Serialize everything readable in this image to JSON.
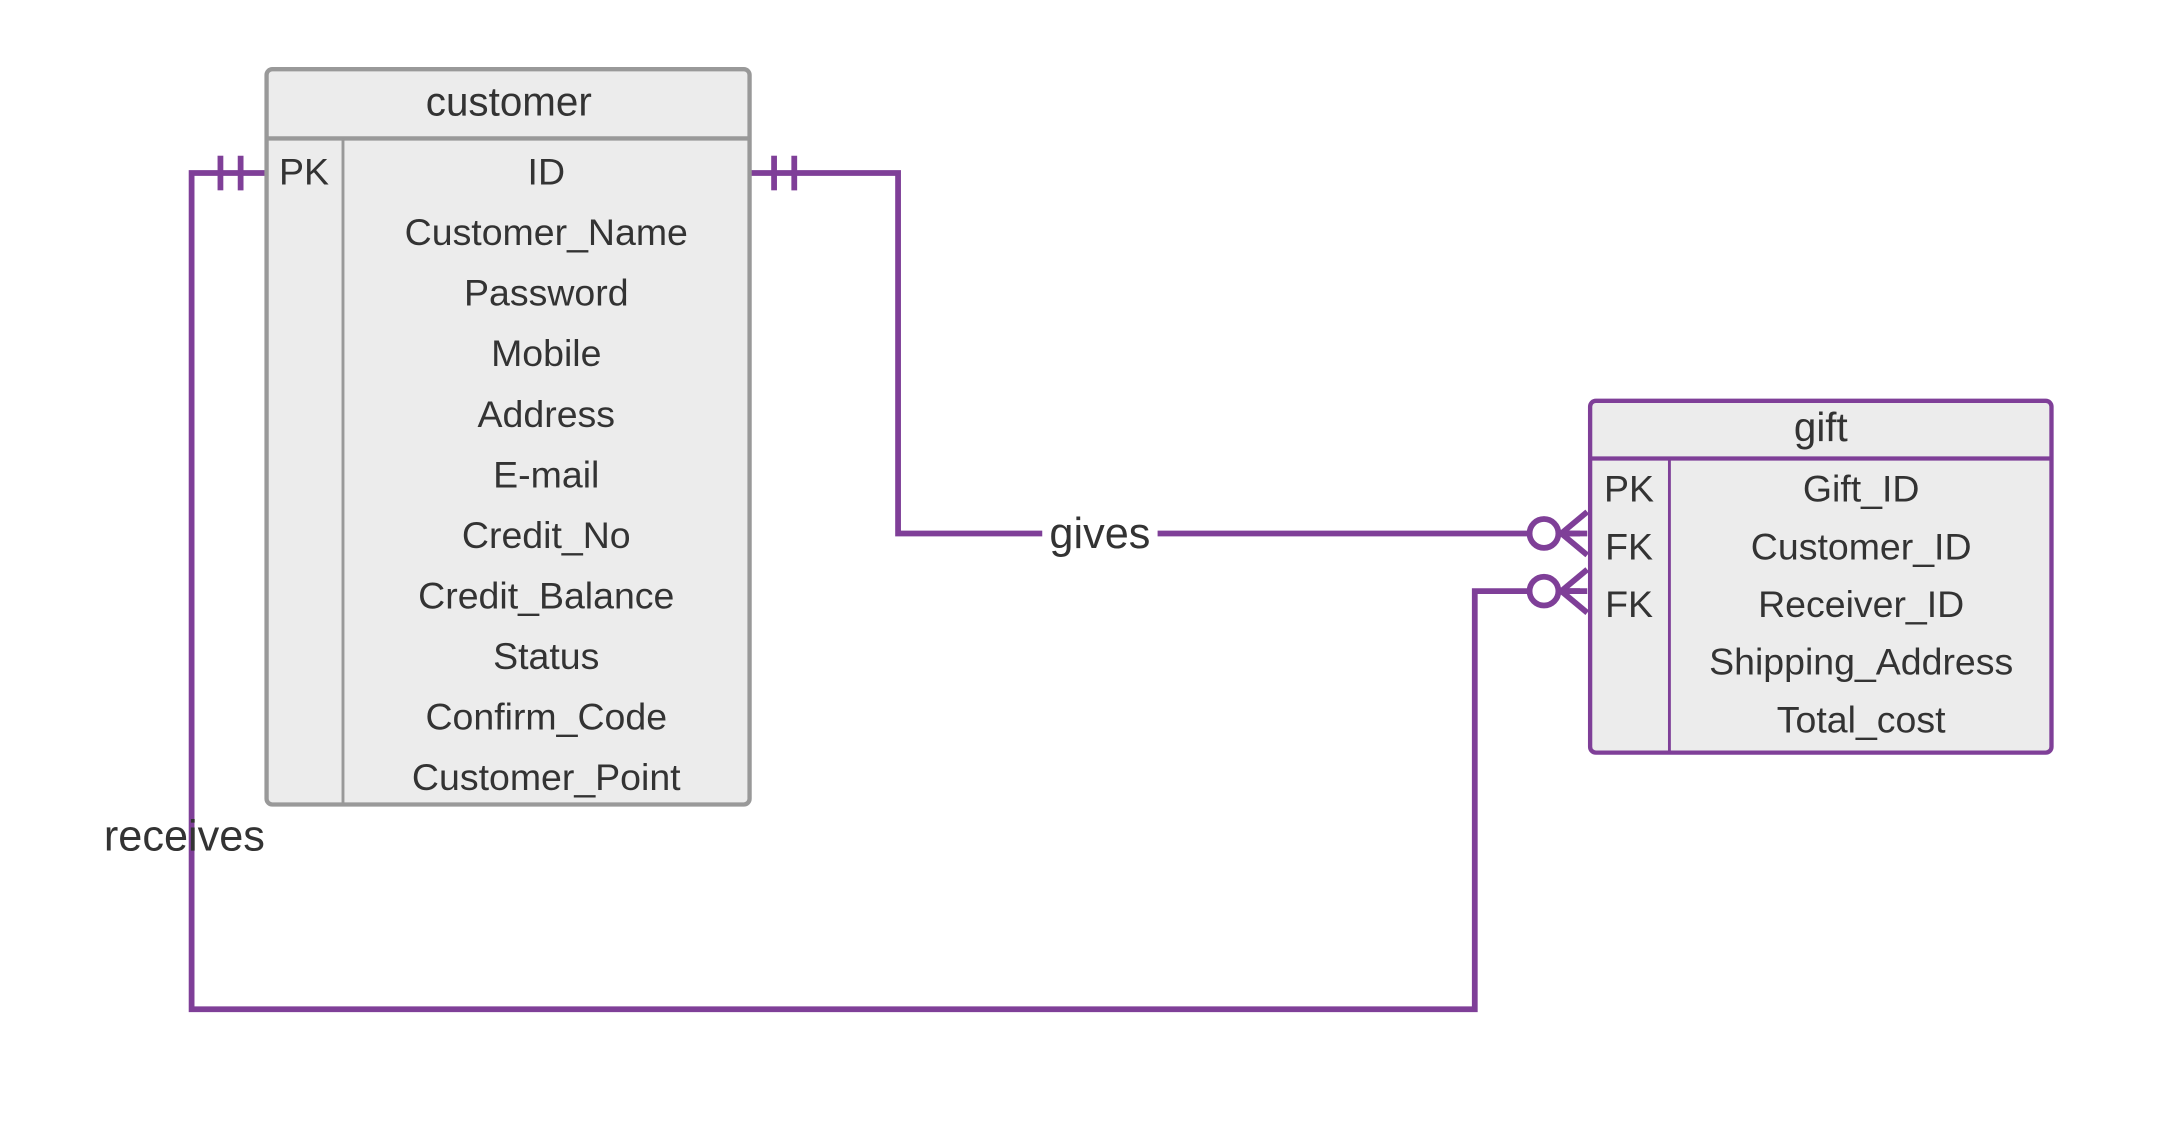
{
  "entities": {
    "customer": {
      "title": "customer",
      "rows": [
        {
          "key": "PK",
          "name": "ID"
        },
        {
          "key": "",
          "name": "Customer_Name"
        },
        {
          "key": "",
          "name": "Password"
        },
        {
          "key": "",
          "name": "Mobile"
        },
        {
          "key": "",
          "name": "Address"
        },
        {
          "key": "",
          "name": "E-mail"
        },
        {
          "key": "",
          "name": "Credit_No"
        },
        {
          "key": "",
          "name": "Credit_Balance"
        },
        {
          "key": "",
          "name": "Status"
        },
        {
          "key": "",
          "name": "Confirm_Code"
        },
        {
          "key": "",
          "name": "Customer_Point"
        }
      ]
    },
    "gift": {
      "title": "gift",
      "rows": [
        {
          "key": "PK",
          "name": "Gift_ID"
        },
        {
          "key": "FK",
          "name": "Customer_ID"
        },
        {
          "key": "FK",
          "name": "Receiver_ID"
        },
        {
          "key": "",
          "name": "Shipping_Address"
        },
        {
          "key": "",
          "name": "Total_cost"
        }
      ]
    }
  },
  "relationships": {
    "gives": {
      "label": "gives"
    },
    "receives": {
      "label": "receives"
    }
  }
}
